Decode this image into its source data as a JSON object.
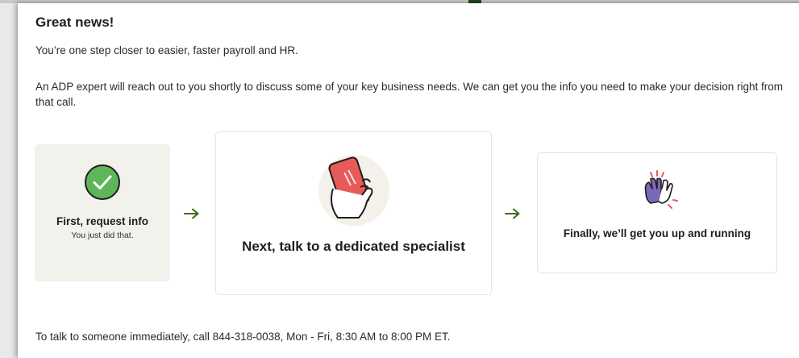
{
  "heading": "Great news!",
  "intro": "You’re one step closer to easier, faster payroll and HR.",
  "details": "An ADP expert will reach out to you shortly to discuss some of your key business needs. We can get you the info you need to make your decision right from that call.",
  "steps": [
    {
      "title": "First, request info",
      "subtitle": "You just did that.",
      "icon": "check-circle-icon"
    },
    {
      "title": "Next, talk to a dedicated specialist",
      "icon": "phone-in-hand-icon"
    },
    {
      "title": "Finally, we’ll get you up and running",
      "icon": "high-five-icon"
    }
  ],
  "arrow_icon": "arrow-right-icon",
  "contact": "To talk to someone immediately, call 844-318-0038, Mon - Fri, 8:30 AM to 8:00 PM ET.",
  "colors": {
    "check_green": "#5fb65a",
    "arrow_green": "#3c6a25",
    "phone_red": "#e85a5a",
    "hand_purple": "#7b68b8"
  }
}
